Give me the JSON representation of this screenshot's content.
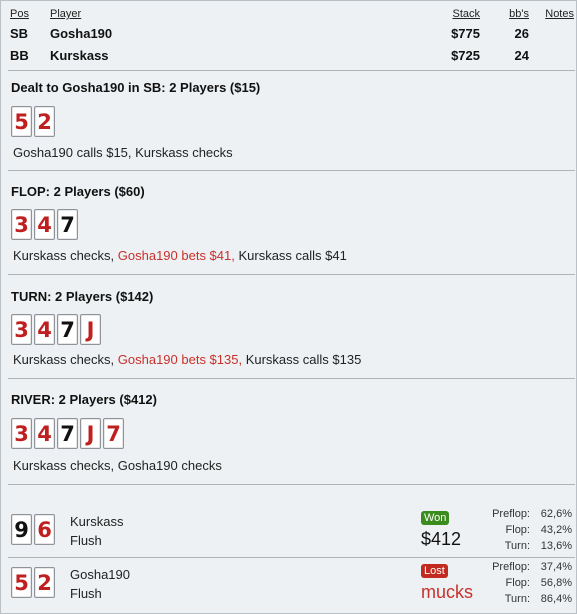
{
  "header": {
    "labels": {
      "pos": "Pos",
      "player": "Player",
      "stack": "Stack",
      "bbs": "bb's",
      "notes": "Notes"
    },
    "players": [
      {
        "pos": "SB",
        "name": "Gosha190",
        "stack": "$775",
        "bbs": "26"
      },
      {
        "pos": "BB",
        "name": "Kurskass",
        "stack": "$725",
        "bbs": "24"
      }
    ]
  },
  "preflop": {
    "title": "Dealt to Gosha190 in SB: 2 Players ($15)",
    "cards": [
      {
        "rank": "5",
        "color": "red"
      },
      {
        "rank": "2",
        "color": "red"
      }
    ],
    "action": "Gosha190 calls $15, Kurskass checks"
  },
  "flop": {
    "title": "FLOP: 2 Players ($60)",
    "cards": [
      {
        "rank": "3",
        "color": "red"
      },
      {
        "rank": "4",
        "color": "red"
      },
      {
        "rank": "7",
        "color": "black"
      }
    ],
    "action_a": "Kurskass checks, ",
    "action_b": "Gosha190 bets $41,",
    "action_c": " Kurskass calls $41"
  },
  "turn": {
    "title": "TURN: 2 Players ($142)",
    "cards": [
      {
        "rank": "3",
        "color": "red"
      },
      {
        "rank": "4",
        "color": "red"
      },
      {
        "rank": "7",
        "color": "black"
      },
      {
        "rank": "J",
        "color": "red"
      }
    ],
    "action_a": "Kurskass checks, ",
    "action_b": "Gosha190 bets $135,",
    "action_c": " Kurskass calls $135"
  },
  "river": {
    "title": "RIVER: 2 Players ($412)",
    "cards": [
      {
        "rank": "3",
        "color": "red"
      },
      {
        "rank": "4",
        "color": "red"
      },
      {
        "rank": "7",
        "color": "black"
      },
      {
        "rank": "J",
        "color": "red"
      },
      {
        "rank": "7",
        "color": "red"
      }
    ],
    "action": "Kurskass checks, Gosha190 checks"
  },
  "showdown": [
    {
      "cards": [
        {
          "rank": "9",
          "color": "black"
        },
        {
          "rank": "6",
          "color": "red"
        }
      ],
      "name": "Kurskass",
      "hand": "Flush",
      "result": "Won",
      "amount": "$412",
      "stats": [
        {
          "label": "Preflop:",
          "value": "62,6%"
        },
        {
          "label": "Flop:",
          "value": "43,2%"
        },
        {
          "label": "Turn:",
          "value": "13,6%"
        }
      ]
    },
    {
      "cards": [
        {
          "rank": "5",
          "color": "red"
        },
        {
          "rank": "2",
          "color": "red"
        }
      ],
      "name": "Gosha190",
      "hand": "Flush",
      "result": "Lost",
      "amount": "mucks",
      "stats": [
        {
          "label": "Preflop:",
          "value": "37,4%"
        },
        {
          "label": "Flop:",
          "value": "56,8%"
        },
        {
          "label": "Turn:",
          "value": "86,4%"
        }
      ]
    }
  ],
  "colors": {
    "red_card": "#c01f20",
    "action_red": "#c8312b",
    "won": "#3b8c1f",
    "lost": "#c22a1f"
  }
}
